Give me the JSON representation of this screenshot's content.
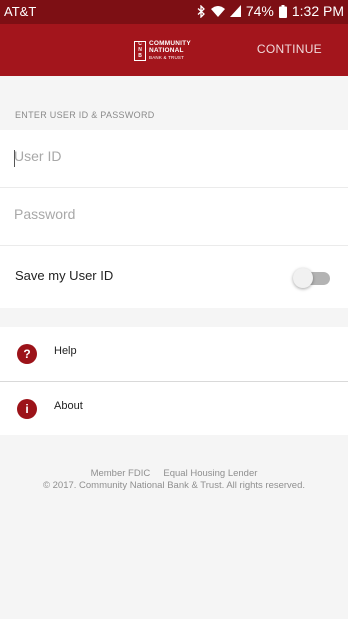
{
  "status_bar": {
    "carrier": "AT&T",
    "battery": "74%",
    "time": "1:32 PM",
    "icons": [
      "bluetooth-icon",
      "wifi-icon",
      "signal-icon",
      "battery-icon"
    ]
  },
  "header": {
    "logo_mark": [
      "C",
      "N",
      "B"
    ],
    "logo_lines": [
      "COMMUNITY",
      "NATIONAL",
      "BANK & TRUST"
    ],
    "continue_label": "CONTINUE"
  },
  "login": {
    "section_label": "ENTER USER ID & PASSWORD",
    "user_id_placeholder": "User ID",
    "password_placeholder": "Password",
    "save_user_id_label": "Save my User ID",
    "save_user_id_enabled": false
  },
  "menu": {
    "items": [
      {
        "icon": "?",
        "icon_name": "help-icon",
        "label": "Help"
      },
      {
        "icon": "i",
        "icon_name": "info-icon",
        "label": "About"
      }
    ]
  },
  "footer": {
    "line1": "Member FDIC     Equal Housing Lender",
    "line2": "© 2017. Community National Bank & Trust. All rights reserved."
  },
  "colors": {
    "brand": "#a3151c",
    "status_bar": "#7d0f14",
    "background": "#f5f5f5"
  }
}
